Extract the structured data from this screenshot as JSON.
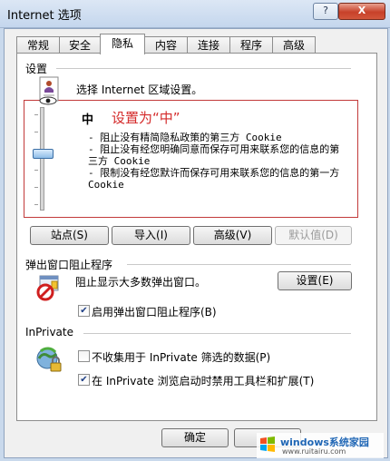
{
  "window": {
    "title": "Internet 选项",
    "help_label": "?",
    "close_label": "X"
  },
  "tabs": [
    "常规",
    "安全",
    "隐私",
    "内容",
    "连接",
    "程序",
    "高级"
  ],
  "settings": {
    "heading": "设置",
    "instruction": "选择 Internet 区域设置。",
    "level_name": "中",
    "annotation": "设置为“中”",
    "descriptions": [
      "- 阻止没有精简隐私政策的第三方 Cookie",
      "- 阻止没有经您明确同意而保存可用来联系您的信息的第三方 Cookie",
      "- 限制没有经您默许而保存可用来联系您的信息的第一方 Cookie"
    ],
    "slider_level_fraction": 0.55
  },
  "buttons": {
    "sites": "站点(S)",
    "import": "导入(I)",
    "advanced": "高级(V)",
    "default": "默认值(D)"
  },
  "popup": {
    "heading": "弹出窗口阻止程序",
    "text": "阻止显示大多数弹出窗口。",
    "settings_button": "设置(E)",
    "enable_label": "启用弹出窗口阻止程序(B)",
    "enable_checked": true
  },
  "inprivate": {
    "heading": "InPrivate",
    "no_collect_label": "不收集用于 InPrivate 筛选的数据(P)",
    "no_collect_checked": false,
    "disable_toolbars_label": "在 InPrivate 浏览启动时禁用工具栏和扩展(T)",
    "disable_toolbars_checked": true
  },
  "footer": {
    "ok_label": "确定"
  },
  "watermark": {
    "brand": "windows系统家园",
    "url": "www.ruitairu.com"
  },
  "colors": {
    "annotation_red": "#d42a2a",
    "frame_blue": "#c9d9ec"
  }
}
